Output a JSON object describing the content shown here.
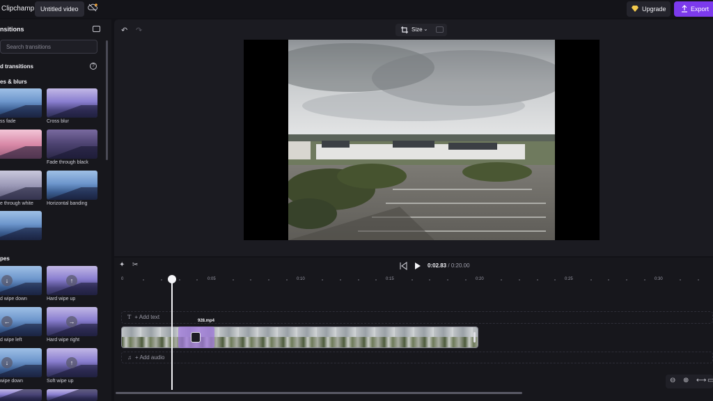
{
  "app": {
    "name": "Clipchamp",
    "project_title": "Untitled video"
  },
  "header": {
    "upgrade_label": "Upgrade",
    "export_label": "Export"
  },
  "panel": {
    "title": "nsitions",
    "search_placeholder": "Search transitions",
    "section_featured": "d transitions",
    "section_fades": "es & blurs",
    "section_wipes": "pes",
    "items": [
      {
        "label": "ss fade",
        "style": "blue"
      },
      {
        "label": "Cross blur",
        "style": "purple"
      },
      {
        "label": "",
        "style": "pink"
      },
      {
        "label": "Fade through black",
        "style": "dark"
      },
      {
        "label": "e through white",
        "style": "grey"
      },
      {
        "label": "Horizontal banding",
        "style": "blue"
      },
      {
        "label": "",
        "style": "blue"
      },
      {
        "label": "d wipe down",
        "style": "blue",
        "arrow": "↓"
      },
      {
        "label": "Hard wipe up",
        "style": "purple",
        "arrow": "↑"
      },
      {
        "label": "d wipe left",
        "style": "blue",
        "arrow": "←"
      },
      {
        "label": "Hard wipe right",
        "style": "purple",
        "arrow": "→"
      },
      {
        "label": "wipe down",
        "style": "blue",
        "arrow": "↓"
      },
      {
        "label": "Soft wipe up",
        "style": "purple",
        "arrow": "↑"
      }
    ]
  },
  "preview": {
    "size_label": "Size"
  },
  "playback": {
    "current_time": "0:02.83",
    "total_time": "/ 0:20.00"
  },
  "timeline": {
    "ruler": [
      "0",
      "0:05",
      "0:10",
      "0:15",
      "0:20",
      "0:25",
      "0:30"
    ],
    "add_text_label": "+ Add text",
    "add_audio_label": "+ Add audio",
    "clip_name": "928.mp4"
  },
  "colors": {
    "accent": "#7c3aed",
    "background": "#121217",
    "panel": "#17171c"
  }
}
